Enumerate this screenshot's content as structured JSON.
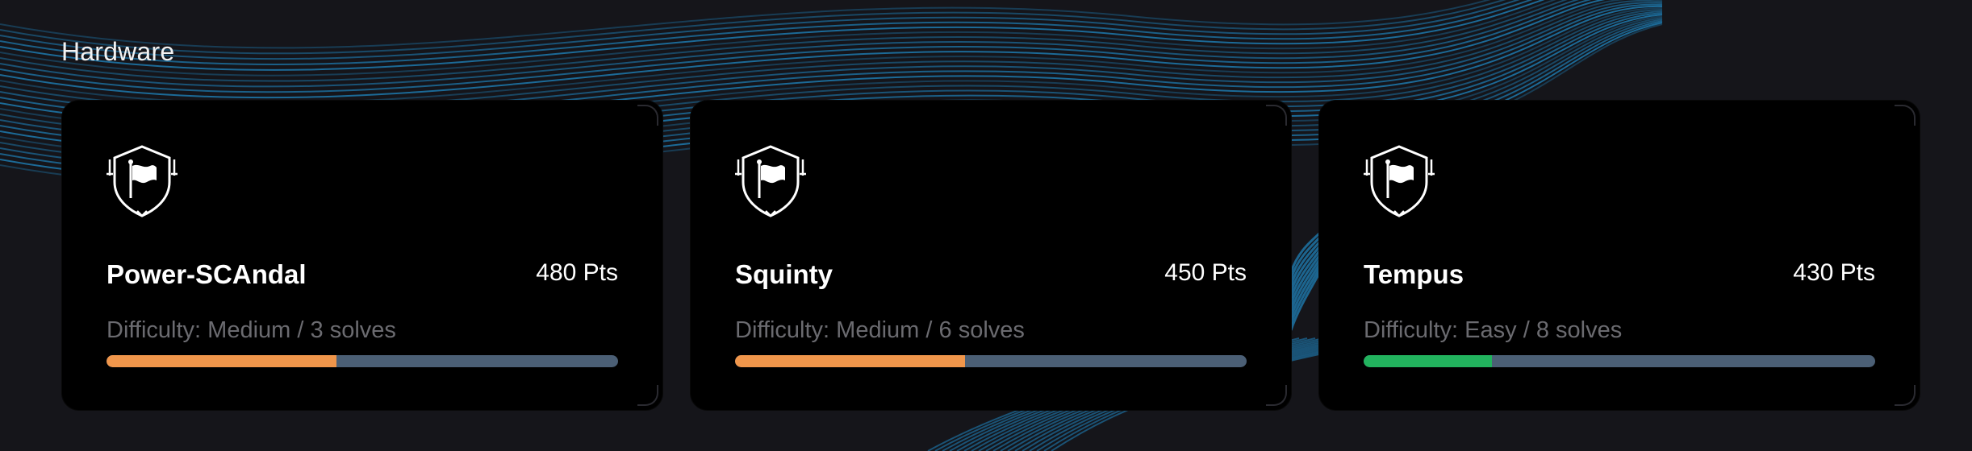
{
  "section": {
    "title": "Hardware"
  },
  "cards": [
    {
      "icon": "shield-flag-icon",
      "name": "Power-SCAndal",
      "points": "480 Pts",
      "difficulty_label": "Difficulty:",
      "difficulty": "Medium",
      "separator": "/",
      "solves": "3 solves",
      "difficulty_fraction": 0.45,
      "bar_color": "#f0964b",
      "track_color": "#4b5f75"
    },
    {
      "icon": "shield-flag-icon",
      "name": "Squinty",
      "points": "450 Pts",
      "difficulty_label": "Difficulty:",
      "difficulty": "Medium",
      "separator": "/",
      "solves": "6 solves",
      "difficulty_fraction": 0.45,
      "bar_color": "#f0964b",
      "track_color": "#4b5f75"
    },
    {
      "icon": "shield-flag-icon",
      "name": "Tempus",
      "points": "430 Pts",
      "difficulty_label": "Difficulty:",
      "difficulty": "Easy",
      "separator": "/",
      "solves": "8 solves",
      "difficulty_fraction": 0.25,
      "bar_color": "#22b35e",
      "track_color": "#4b5f75"
    }
  ],
  "colors": {
    "background": "#15151a",
    "card": "#000000",
    "accent_lines": "#1f87c2"
  }
}
